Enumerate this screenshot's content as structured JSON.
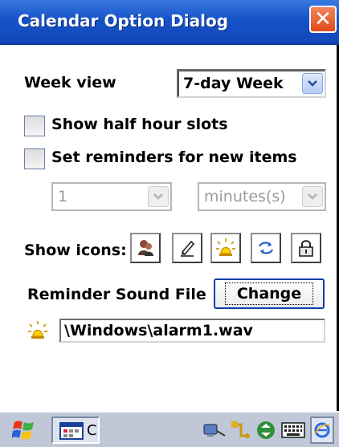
{
  "window": {
    "title": "Calendar Option Dialog",
    "close_label": "✕"
  },
  "week_view": {
    "label": "Week view",
    "value": "7-day Week"
  },
  "options": {
    "half_hour_slots": {
      "label": "Show half hour slots",
      "checked": false
    },
    "reminders": {
      "label": "Set reminders for new items",
      "checked": false
    }
  },
  "reminder_amount": {
    "value": "1",
    "disabled": true
  },
  "reminder_unit": {
    "value": "minutes(s)",
    "disabled": true
  },
  "show_icons": {
    "label": "Show icons:",
    "icons": [
      "attendees-icon",
      "notes-icon",
      "reminder-icon",
      "recurrence-icon",
      "private-icon"
    ]
  },
  "reminder_sound": {
    "label": "Reminder Sound File",
    "button_label": "Change",
    "file_path": "\\Windows\\alarm1.wav"
  },
  "taskbar": {
    "running_app_label": "C"
  },
  "colors": {
    "titlebar": "#1653c9",
    "close": "#e04b1c",
    "taskbar": "#c0c8d8"
  }
}
